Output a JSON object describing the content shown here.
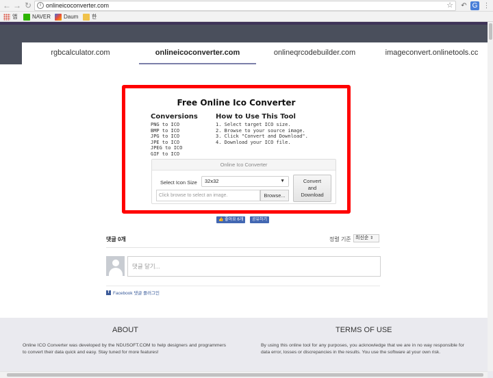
{
  "browser": {
    "url": "onlineicoconverter.com",
    "bookmarks": [
      "앱",
      "NAVER",
      "Daum",
      "한"
    ]
  },
  "site_nav": {
    "tabs": [
      {
        "label": "rgbcalculator.com",
        "active": false
      },
      {
        "label": "onlineicoconverter.com",
        "active": true
      },
      {
        "label": "onlineqrcodebuilder.com",
        "active": false
      },
      {
        "label": "imageconvert.onlinetools.cc",
        "active": false
      }
    ]
  },
  "converter": {
    "title": "Free Online Ico Converter",
    "conversions": {
      "heading": "Conversions",
      "items": [
        "PNG to ICO",
        "BMP to ICO",
        "JPG to ICO",
        "JPE to ICO",
        "JPEG to ICO",
        "GIF to ICO"
      ]
    },
    "howto": {
      "heading": "How to Use This Tool",
      "steps": [
        "1. Select target ICO size.",
        "2. Browse to your source image.",
        "3. Click \"Convert and Download\".",
        "4. Download your ICO file."
      ]
    },
    "panel_title": "Online Ico Converter",
    "size_label": "Select Icon Size",
    "size_value": "32x32",
    "file_placeholder": "Click browse to select an image.",
    "browse_label": "Browse...",
    "convert_label_1": "Convert",
    "convert_label_2": "and",
    "convert_label_3": "Download"
  },
  "social": {
    "like_label": "좋아요 6개",
    "share_label": "공유하기"
  },
  "comments": {
    "count_label": "댓글 0개",
    "sort_label": "정렬 기준",
    "sort_value": "최신순",
    "input_placeholder": "댓글 달기...",
    "plugin_label": "Facebook 댓글 플러그인"
  },
  "footer": {
    "about_title": "ABOUT",
    "about_text": "Online ICO Converter was developed by the NDUSOFT.COM to help designers and programmers to convert their data quick and easy. Stay tuned for more features!",
    "terms_title": "TERMS OF USE",
    "terms_text": "By using this online tool for any purposes, you acknowledge that we are in no way responsible for data error, losses or discrepancies in the results. You use the software at your own risk."
  }
}
